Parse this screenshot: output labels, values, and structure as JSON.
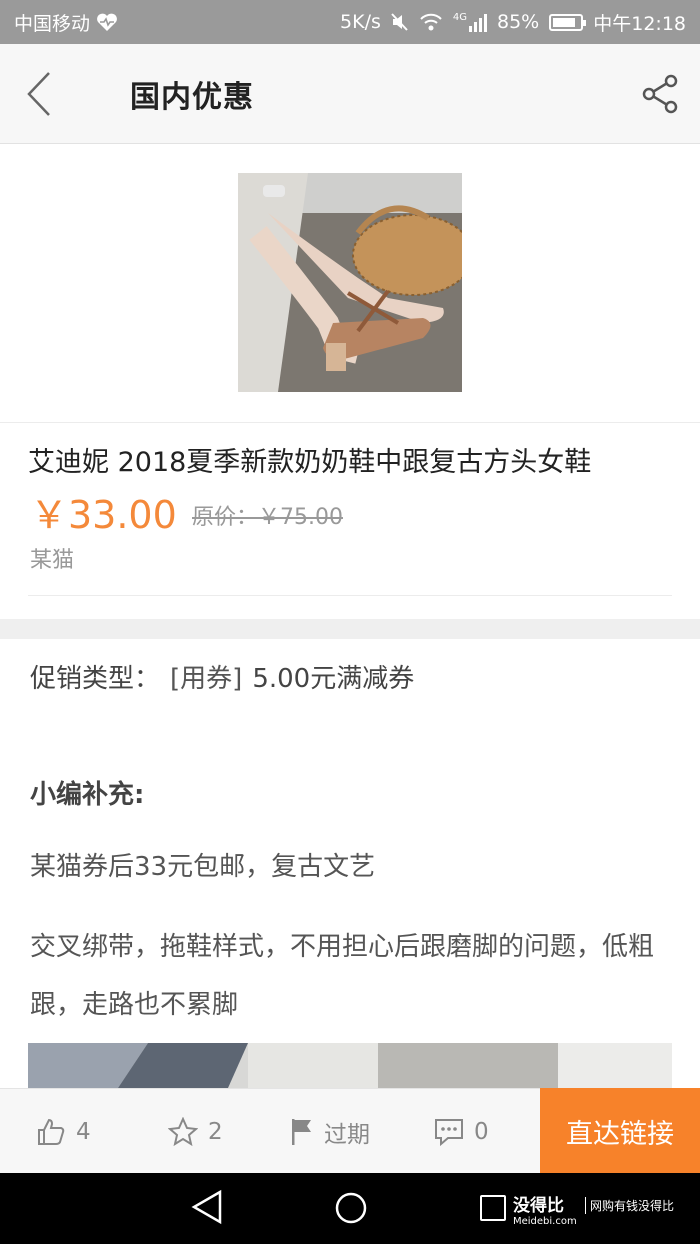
{
  "status_bar": {
    "carrier": "中国移动",
    "net_speed": "5K/s",
    "network": "4G",
    "battery": "85%",
    "battery_level": 0.85,
    "time": "中午12:18"
  },
  "header": {
    "title": "国内优惠"
  },
  "product": {
    "title": "艾迪妮 2018夏季新款奶奶鞋中跟复古方头女鞋",
    "price": "￥33.00",
    "original_price": "原价：￥75.00",
    "shop": "某猫"
  },
  "promo": {
    "label": "促销类型：",
    "tag": "[用券]",
    "text": "5.00元满减券"
  },
  "editor": {
    "title": "小编补充:",
    "para1": "某猫券后33元包邮，复古文艺",
    "para2": "交叉绑带，拖鞋样式，不用担心后跟磨脚的问题，低粗跟，走路也不累脚"
  },
  "actions": {
    "likes": "4",
    "favorites": "2",
    "expire_label": "过期",
    "comments": "0",
    "direct_link": "直达链接"
  },
  "watermark": {
    "name": "没得比",
    "domain": "Meidebi.com",
    "slogan": "网购有钱没得比"
  },
  "colors": {
    "accent": "#f7822a",
    "price": "#f4893a"
  }
}
